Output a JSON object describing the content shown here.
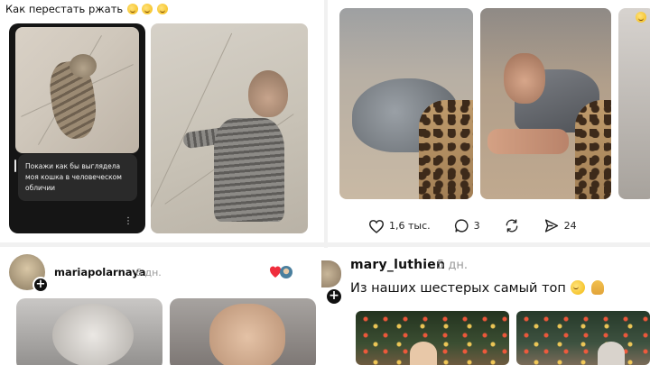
{
  "top_left": {
    "caption": "Как перестать ржать",
    "caption_emojis": [
      "grinning-squint-emoji",
      "grinning-squint-emoji",
      "grinning-squint-emoji"
    ],
    "story_message": "Покажи как бы выглядела моя кошка в человеческом обличии",
    "story_more_icon": "vertical-dots-icon"
  },
  "top_right": {
    "likes": "1,6 тыс.",
    "comments": "3",
    "shares": "24",
    "icons": [
      "heart-icon",
      "comment-icon",
      "repost-icon",
      "send-icon"
    ]
  },
  "bottom_left": {
    "username": "mariapolarnaya",
    "time": "6 дн."
  },
  "bottom_right": {
    "username": "mary_luthien",
    "time": "5 дн.",
    "text": "Из наших шестерых самый топ"
  },
  "colors": {
    "story_bg": "#151515",
    "bubble_bg": "#2a2a2a",
    "secondary_text": "#999999"
  }
}
